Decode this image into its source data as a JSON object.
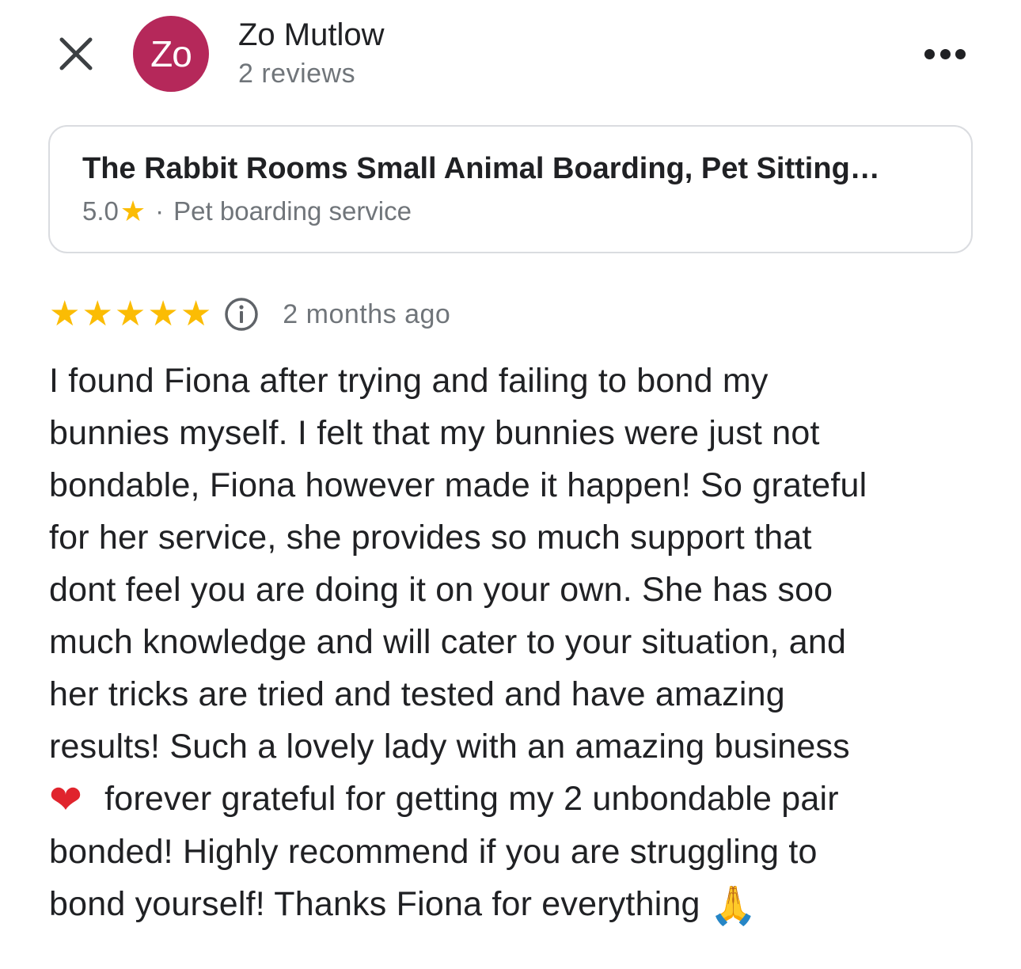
{
  "header": {
    "close_icon": "close-icon",
    "avatar_initials": "Zo",
    "user_name": "Zo Mutlow",
    "review_count": "2 reviews",
    "more_icon": "more-horiz-icon"
  },
  "place": {
    "name": "The Rabbit Rooms Small Animal Boarding, Pet Sitting…",
    "rating": "5.0",
    "separator": "·",
    "category": "Pet boarding service"
  },
  "review": {
    "star_count": 5,
    "date": "2 months ago",
    "lines": [
      "I found Fiona after trying and failing to bond my",
      "bunnies myself. I felt that my bunnies were just not",
      "bondable, Fiona however made it happen! So grateful",
      "for her service, she provides so much support that",
      "dont feel you are doing it on your own. She has soo",
      "much knowledge and will cater to your situation, and",
      "her tricks are tried and tested and have amazing",
      "results! Such a lovely lady with an amazing business",
      "forever grateful for getting my 2 unbondable pair",
      "bonded! Highly recommend if you are struggling to",
      "bond yourself! Thanks Fiona for everything"
    ],
    "heart_emoji": "❤",
    "pray_emoji": "🙏"
  },
  "colors": {
    "avatar_bg": "#b5285a",
    "star": "#fbbc04",
    "secondary_text": "#70757a",
    "card_border": "#dadce0"
  }
}
